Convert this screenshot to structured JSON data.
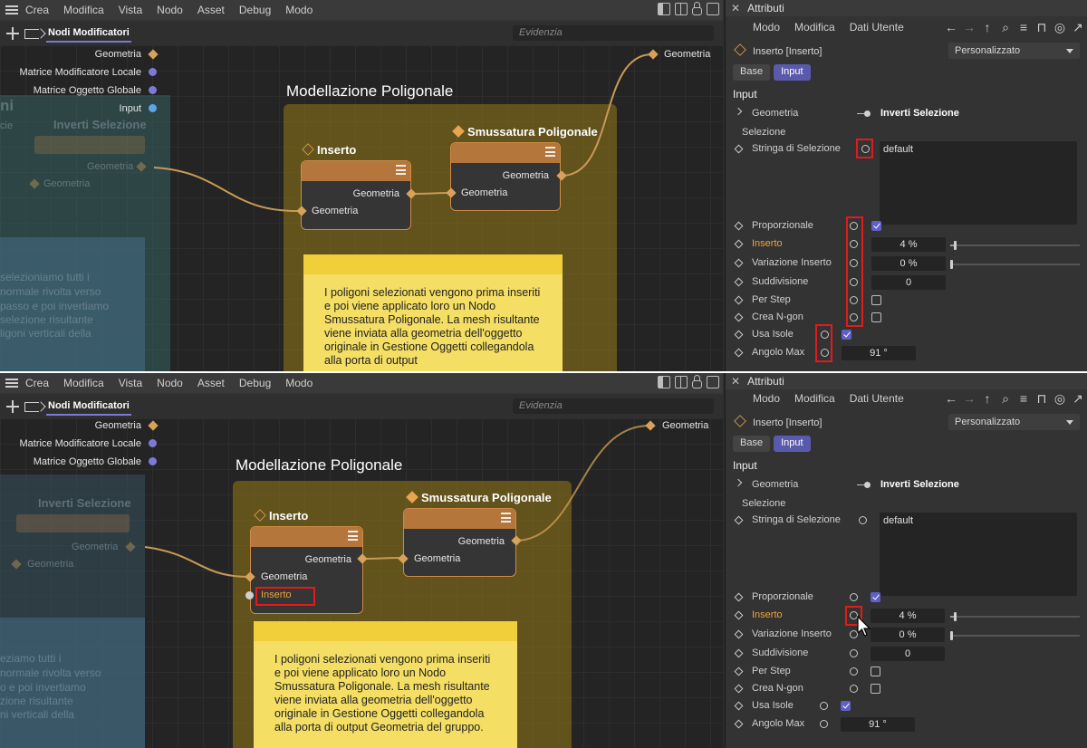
{
  "menu": [
    "Crea",
    "Modifica",
    "Vista",
    "Nodo",
    "Asset",
    "Debug",
    "Modo"
  ],
  "editor": {
    "tab": "Nodi Modificatori",
    "search_placeholder": "Evidenzia",
    "left_ports": {
      "geometria": "Geometria",
      "matrice_locale": "Matrice Modificatore Locale",
      "matrice_globale": "Matrice Oggetto Globale",
      "input": "Input"
    },
    "right_port": "Geometria",
    "group_title": "Modellazione Poligonale",
    "node_inserto": {
      "title": "Inserto",
      "out_port": "Geometria",
      "in_port": "Geometria",
      "extra_port": "Inserto"
    },
    "node_smussatura": {
      "title": "Smussatura Poligonale",
      "out_port": "Geometria",
      "in_port": "Geometria"
    },
    "ghost_node_title": "Inverti Selezione",
    "ghost_port_out": "Geometria",
    "ghost_port_in": "Geometria",
    "ghost_group_label": "ni",
    "ghost_cie": "cie",
    "note_text_top": "I poligoni selezionati vengono prima inseriti e poi viene applicato loro un Nodo Smussatura Poligonale. La mesh risultante viene inviata alla geometria dell'oggetto originale in Gestione Oggetti collegandola alla porta di output",
    "note_text_bottom": "I poligoni selezionati vengono prima inseriti e poi viene applicato loro un Nodo Smussatura Poligonale. La mesh risultante viene inviata alla geometria dell'oggetto originale in Gestione Oggetti collegandola alla porta di output Geometria del gruppo.",
    "ghost_note_top": [
      "selezioniamo tutti i",
      "normale rivolta verso",
      "passo e poi invertiamo",
      "selezione risultante",
      "ligoni verticali della"
    ],
    "ghost_note_bottom": [
      "eziamo tutti i",
      "normale rivolta verso",
      "o e poi invertiamo",
      "zione risultante",
      "ni verticali della"
    ]
  },
  "attrs": {
    "title": "Attributi",
    "menu": [
      "Modo",
      "Modifica",
      "Dati Utente"
    ],
    "object": "Inserto [Inserto]",
    "preset": "Personalizzato",
    "tabs": [
      "Base",
      "Input"
    ],
    "section": "Input",
    "geometria_label": "Geometria",
    "geometria_value": "Inverti Selezione",
    "selezione_label": "Selezione",
    "stringa_label": "Stringa di Selezione",
    "stringa_value": "default",
    "rows": {
      "proporzionale": "Proporzionale",
      "inserto": "Inserto",
      "inserto_value": "4 %",
      "variazione": "Variazione Inserto",
      "variazione_value": "0 %",
      "suddivisione": "Suddivisione",
      "suddivisione_value": "0",
      "per_step": "Per Step",
      "crea_ngon": "Crea N-gon",
      "usa_isole": "Usa Isole",
      "angolo_max": "Angolo Max",
      "angolo_value": "91 °"
    },
    "inserto_fraction": 0.04,
    "proporzionale_checked": true,
    "per_step_checked": false,
    "crea_ngon_checked": false,
    "usa_isole_checked": true
  },
  "colors": {
    "accent": "#5a5aad",
    "node_header": "#b4763a",
    "group_fill": "#967814",
    "note_fill": "#f4de64",
    "highlight_red": "#e11b1b",
    "parameter_highlight": "#f0a43a"
  }
}
